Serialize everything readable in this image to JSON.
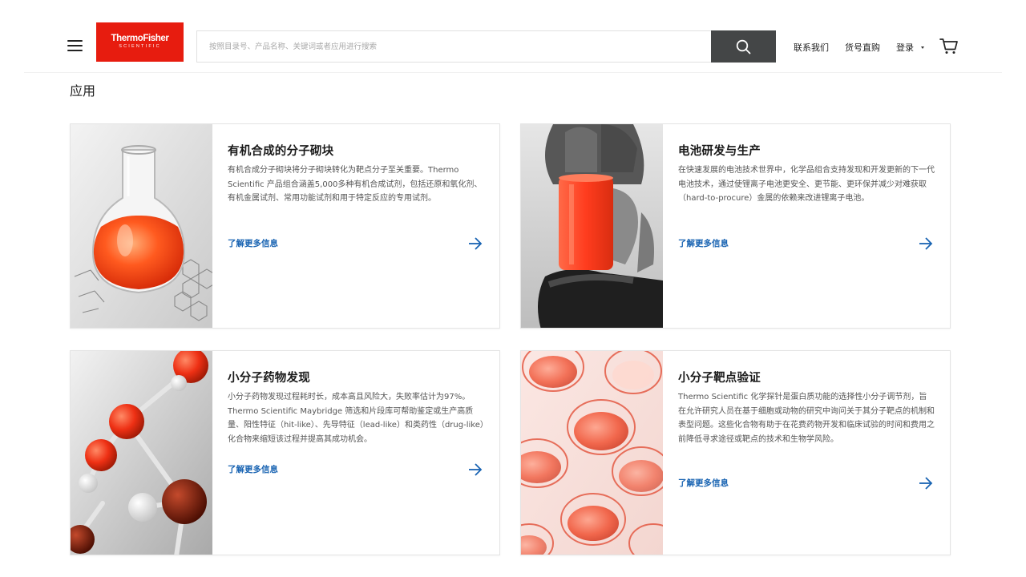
{
  "header": {
    "menu_icon": "hamburger-menu-icon",
    "logo": {
      "line1": "ThermoFisher",
      "line2": "SCIENTIFIC",
      "color": "#e71c0f"
    },
    "search": {
      "placeholder": "按照目录号、产品名称、关键词或者应用进行搜索",
      "icon": "search-icon",
      "button_color": "#444647"
    },
    "nav": {
      "contact": "联系我们",
      "order": "货号直购",
      "login": "登录",
      "cart_icon": "shopping-cart-icon"
    }
  },
  "section": {
    "title": "应用"
  },
  "cards": [
    {
      "title": "有机合成的分子砌块",
      "description": "有机合成分子砌块将分子砌块转化为靶点分子至关重要。Thermo Scientific 产品组合涵盖5,000多种有机合成试剂，包括还原和氧化剂、有机金属试剂、常用功能试剂和用于特定反应的专用试剂。",
      "link": "了解更多信息",
      "image": "orange-flask-molecule-image"
    },
    {
      "title": "电池研发与生产",
      "description": "在快速发展的电池技术世界中，化学品组合支持发现和开发更新的下一代电池技术，通过使锂离子电池更安全、更节能、更环保并减少对难获取（hard-to-procure）金属的依赖来改进锂离子电池。",
      "link": "了解更多信息",
      "image": "hand-holding-battery-image"
    },
    {
      "title": "小分子药物发现",
      "description": "小分子药物发现过程耗时长，成本高且风险大，失败率估计为97%。Thermo Scientific Maybridge 筛选和片段库可帮助鉴定或生产高质量、阳性特征（hit-like）、先导特征（lead-like）和类药性（drug-like）化合物来缩短该过程并提高其成功机会。",
      "link": "了解更多信息",
      "image": "molecule-model-image"
    },
    {
      "title": "小分子靶点验证",
      "description": "Thermo Scientific 化学探针是蛋白质功能的选择性小分子调节剂，旨在允许研究人员在基于细胞或动物的研究中询问关于其分子靶点的机制和表型问题。这些化合物有助于在花费药物开发和临床试验的时间和费用之前降低寻求途径或靶点的技术和生物学风险。",
      "link": "了解更多信息",
      "image": "petri-dishes-image"
    }
  ],
  "colors": {
    "link": "#1863b2",
    "accent_red": "#e71c0f"
  }
}
